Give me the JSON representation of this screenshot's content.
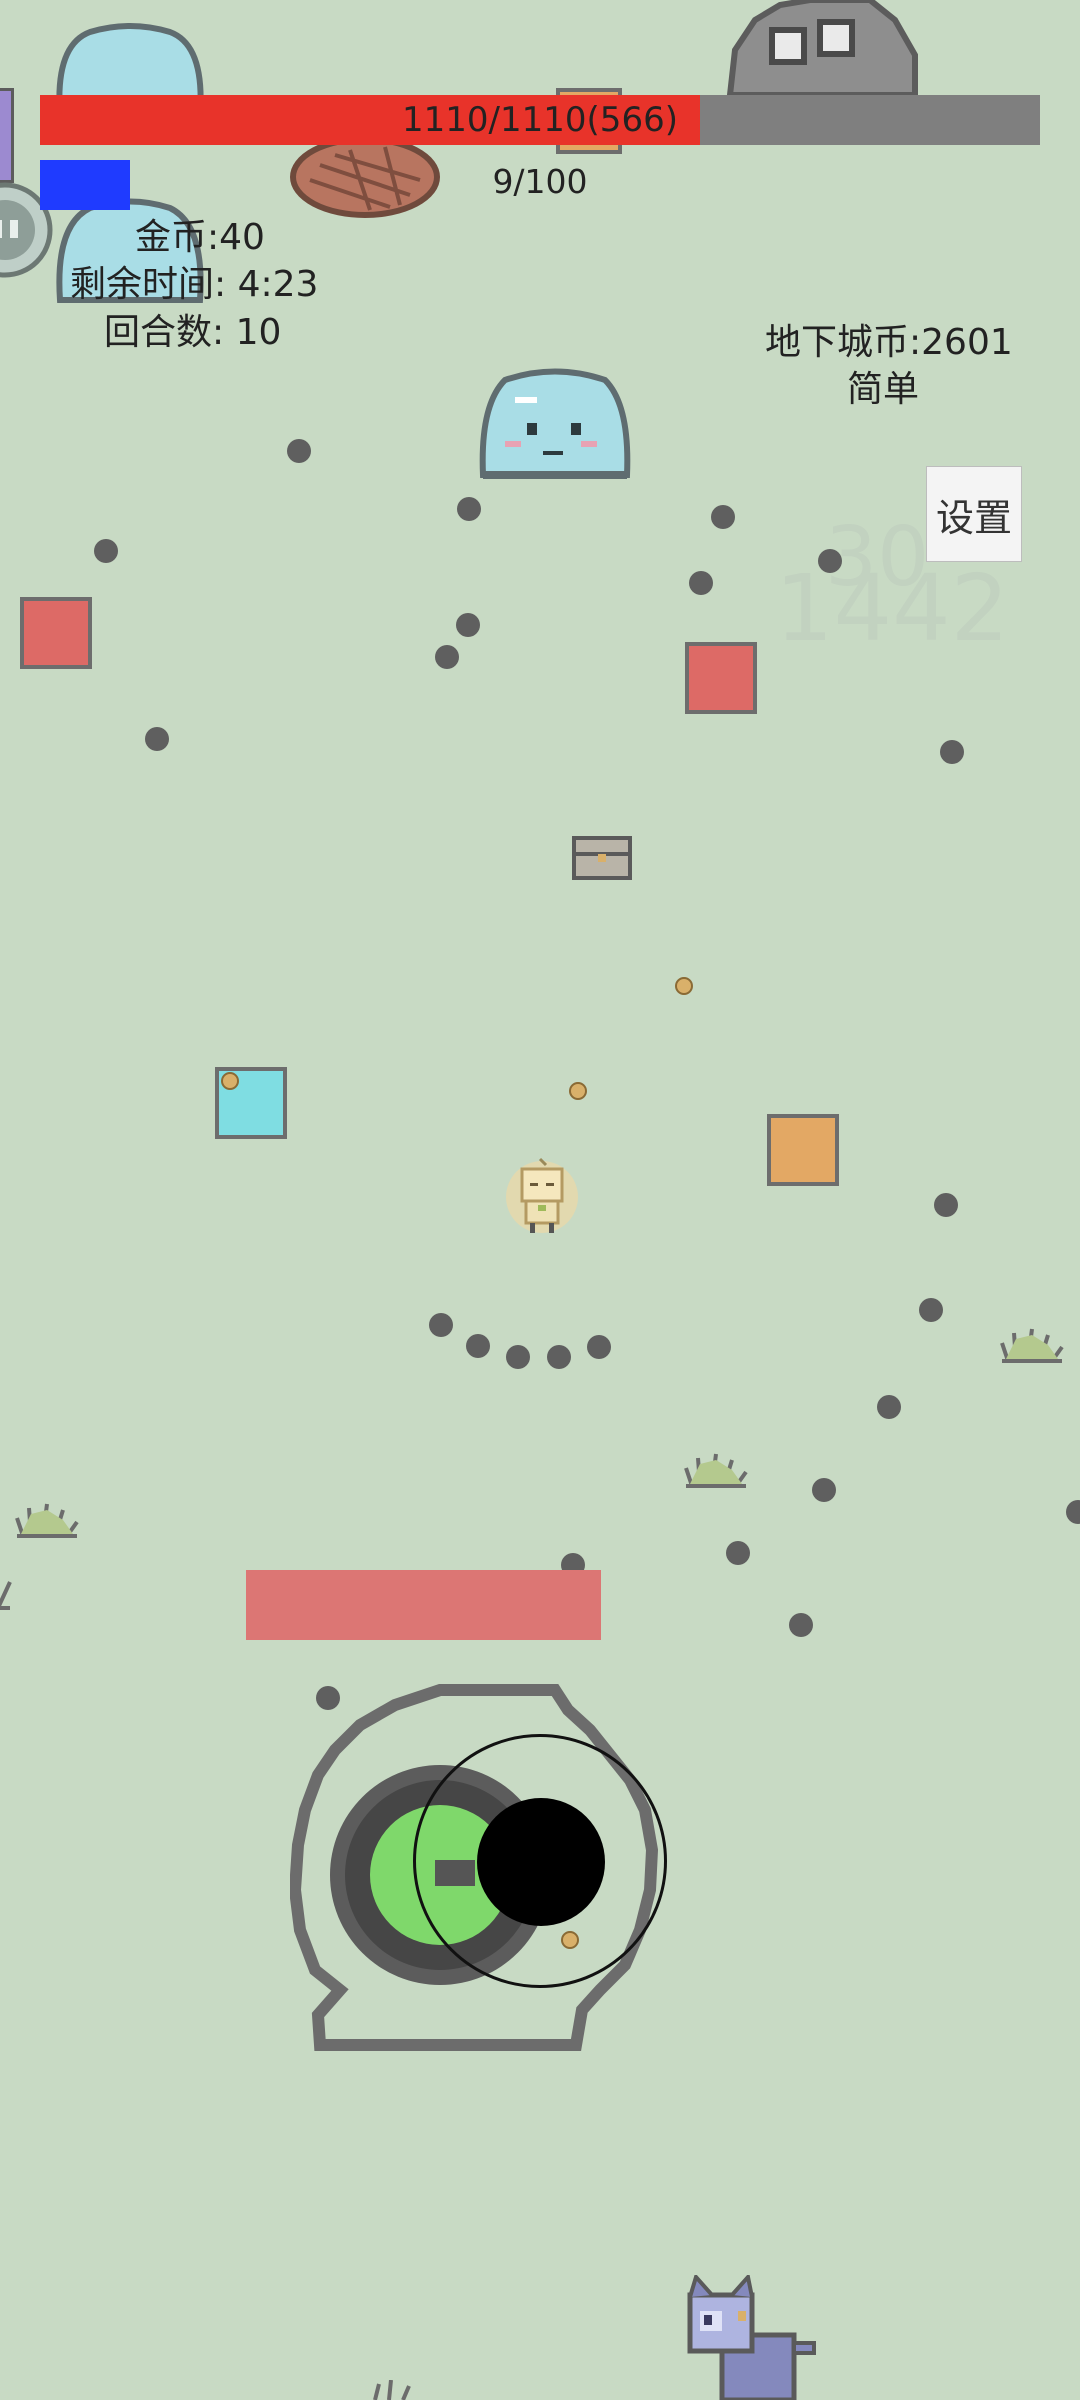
{
  "hud": {
    "hp_text": "1110/1110(566)",
    "hp_fraction": 0.66,
    "exp_text": "9/100",
    "exp_fraction": 0.09,
    "gold": "金币:40",
    "time_left": "剩余时间:  4:23",
    "round": "回合数:  10",
    "dungeon_coins": "地下城币:2601",
    "difficulty": "简单",
    "settings_label": "设置",
    "faded_number_a": "30",
    "faded_number_b": "1442"
  },
  "colors": {
    "background": "#c8dac4",
    "hp": "#e8332a",
    "exp": "#1f3bff",
    "bullet": "#5f5f5f"
  }
}
